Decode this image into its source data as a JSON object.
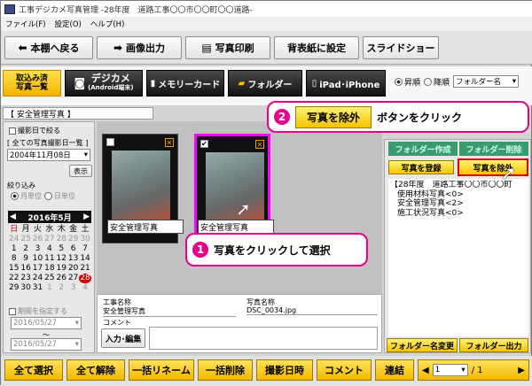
{
  "window": {
    "title": "工事デジカメ写真管理 -28年度　道路工事〇〇市〇〇町〇〇道路-"
  },
  "menu": [
    "ファイル(F)",
    "設定(O)",
    "ヘルプ(H)"
  ],
  "toolbar1": {
    "back": "本棚へ戻る",
    "export": "画像出力",
    "print": "写真印刷",
    "bg": "背表紙に設定",
    "slide": "スライドショー"
  },
  "toolbar2": {
    "imported": "取込み済\n写真一覧",
    "digicam": "デジカメ",
    "digicam_sub": "(Android端末)",
    "memcard": "メモリーカード",
    "folder": "フォルダー",
    "iphone": "iPad･iPhone",
    "asc": "昇順",
    "desc": "降順",
    "sort_select": "フォルダー名"
  },
  "section": {
    "title": "【 安全管理写真 】"
  },
  "left": {
    "narrow_label": "撮影日で絞る",
    "all_dates": "[ 全ての写真撮影日一覧 ]",
    "date_value": "2004年11月08日",
    "show": "表示",
    "filter_label": "絞り込み",
    "by_month": "月単位",
    "by_day": "日単位",
    "cal_title": "2016年5月",
    "weekdays": [
      "日",
      "月",
      "火",
      "水",
      "木",
      "金",
      "土"
    ],
    "days": [
      "24",
      "25",
      "26",
      "27",
      "28",
      "29",
      "30",
      "1",
      "2",
      "3",
      "4",
      "5",
      "6",
      "7",
      "8",
      "9",
      "10",
      "11",
      "12",
      "13",
      "14",
      "15",
      "16",
      "17",
      "18",
      "19",
      "20",
      "21",
      "22",
      "23",
      "24",
      "25",
      "26",
      "27",
      "28",
      "29",
      "30",
      "31",
      "1",
      "2",
      "3",
      "4"
    ],
    "period_label": "期間を指定する",
    "period_from": "2016/05/27",
    "tilde": "～",
    "period_to": "2016/05/27"
  },
  "thumbs": [
    {
      "caption": "安全管理写真"
    },
    {
      "caption": "安全管理写真"
    }
  ],
  "info": {
    "work_name_label": "工事名称",
    "work_name": "安全管理写真",
    "photo_name_label": "写真名称",
    "photo_name": "DSC_0034.jpg",
    "comment_label": "コメント",
    "edit": "入力･編集"
  },
  "right": {
    "folder_create": "フォルダー作成",
    "folder_delete": "フォルダー削除",
    "register": "写真を登録",
    "remove": "写真を除外",
    "tree": [
      "【28年度　道路工事〇〇市〇〇町",
      "使用材料写真<0>",
      "安全管理写真<2>",
      "施工状況写真<0>"
    ],
    "rename": "フォルダー名変更",
    "folder_export": "フォルダー出力"
  },
  "bottom": {
    "select_all": "全て選択",
    "deselect_all": "全て解除",
    "bulk_rename": "一括リネーム",
    "bulk_delete": "一括削除",
    "shot_date": "撮影日時",
    "comment": "コメント",
    "link": "連結",
    "page_current": "1",
    "page_total": "/ 1"
  },
  "callouts": {
    "one_num": "1",
    "one_text": "写真をクリックして選択",
    "two_num": "2",
    "two_btn": "写真を除外",
    "two_text": "ボタンをクリック"
  },
  "colors": {
    "accent_yellow": "#f4c400",
    "callout_magenta": "#e8008a"
  }
}
